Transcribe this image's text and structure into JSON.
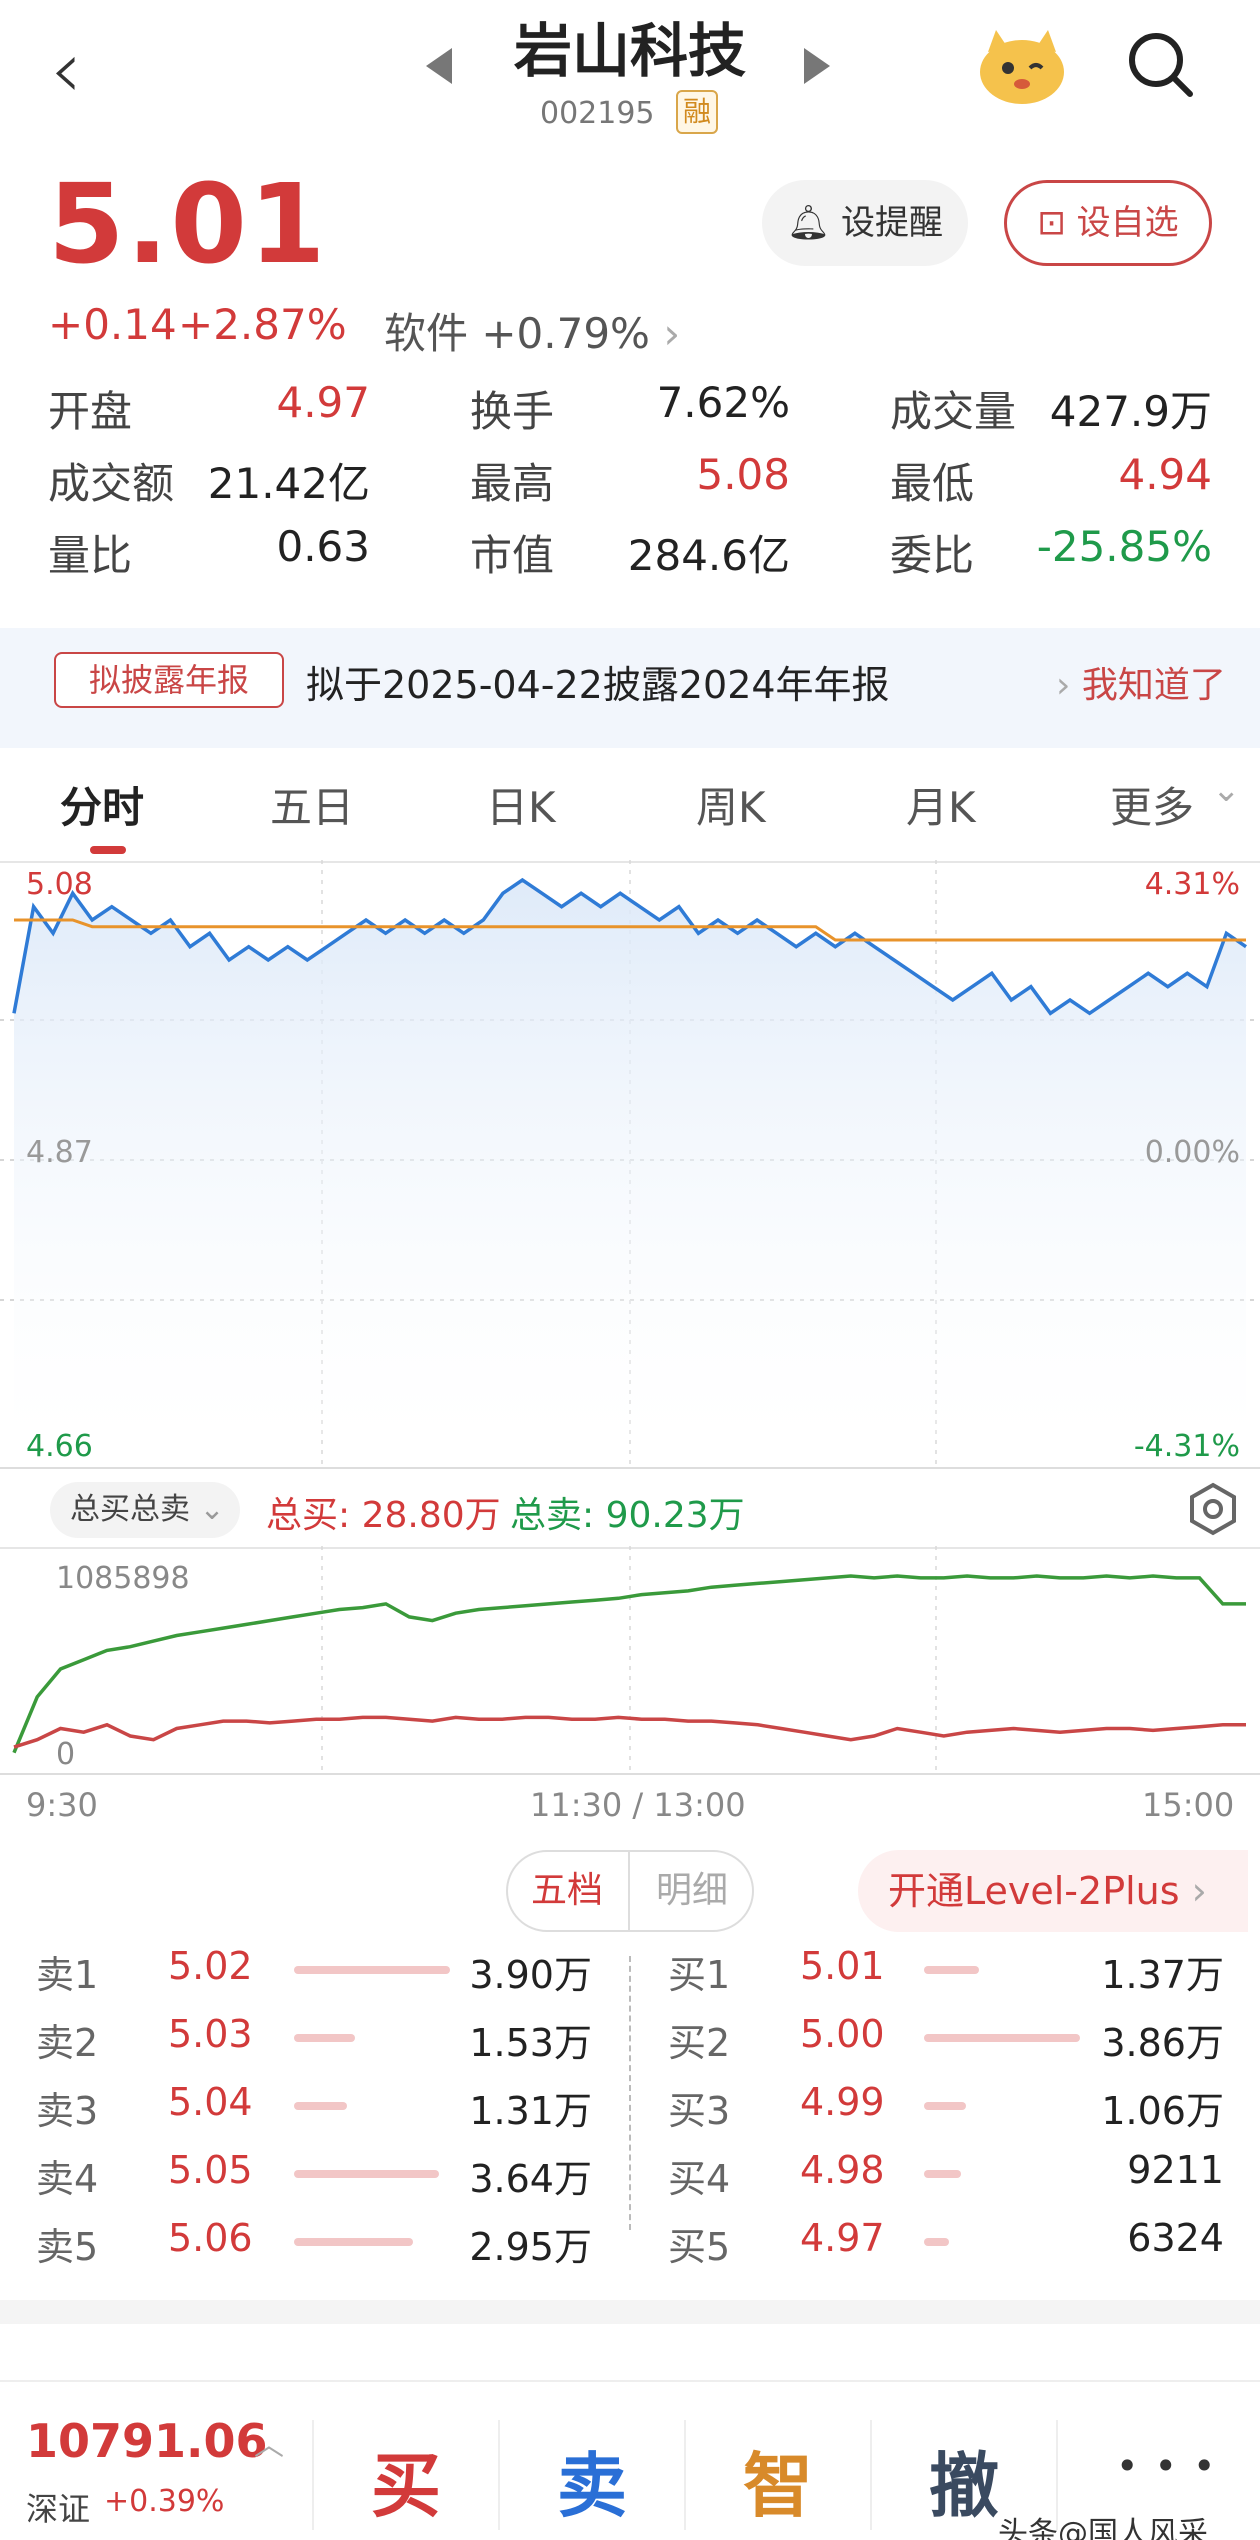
{
  "header": {
    "title": "岩山科技",
    "code": "002195",
    "badge": "融"
  },
  "quote": {
    "price": "5.01",
    "change": "+0.14",
    "change_pct": "+2.87%",
    "sector": "软件 +0.79%",
    "remind_label": "设提醒",
    "watch_label": "设自选"
  },
  "stats": [
    {
      "k": "开盘",
      "v": "4.97",
      "color": "red"
    },
    {
      "k": "换手",
      "v": "7.62%",
      "color": "dark"
    },
    {
      "k": "成交量",
      "v": "427.9万",
      "color": "dark"
    },
    {
      "k": "成交额",
      "v": "21.42亿",
      "color": "dark"
    },
    {
      "k": "最高",
      "v": "5.08",
      "color": "red"
    },
    {
      "k": "最低",
      "v": "4.94",
      "color": "red"
    },
    {
      "k": "量比",
      "v": "0.63",
      "color": "dark"
    },
    {
      "k": "市值",
      "v": "284.6亿",
      "color": "dark"
    },
    {
      "k": "委比",
      "v": "-25.85%",
      "color": "green"
    }
  ],
  "notice": {
    "badge": "拟披露年报",
    "text": "拟于2025-04-22披露2024年年报",
    "ack": "我知道了"
  },
  "tabs": [
    "分时",
    "五日",
    "日K",
    "周K",
    "月K",
    "更多"
  ],
  "chart_data": {
    "type": "line",
    "price_axis": {
      "top": "5.08",
      "mid": "4.87",
      "bottom": "4.66"
    },
    "pct_axis": {
      "top": "4.31%",
      "mid": "0.00%",
      "bottom": "-4.31%"
    },
    "time_labels": [
      "9:30",
      "11:30 / 13:00",
      "15:00"
    ],
    "series": [
      {
        "color": "#2f7bd6",
        "values": [
          4.98,
          5.06,
          5.04,
          5.07,
          5.05,
          5.06,
          5.05,
          5.04,
          5.05,
          5.03,
          5.04,
          5.02,
          5.03,
          5.02,
          5.03,
          5.02,
          5.03,
          5.04,
          5.05,
          5.04,
          5.05,
          5.04,
          5.05,
          5.04,
          5.05,
          5.07,
          5.08,
          5.07,
          5.06,
          5.07,
          5.06,
          5.07,
          5.06,
          5.05,
          5.06,
          5.04,
          5.05,
          5.04,
          5.05,
          5.04,
          5.03,
          5.04,
          5.03,
          5.04,
          5.03,
          5.02,
          5.01,
          5.0,
          4.99,
          5.0,
          5.01,
          4.99,
          5.0,
          4.98,
          4.99,
          4.98,
          4.99,
          5.0,
          5.01,
          5.0,
          5.01,
          5.0,
          5.04,
          5.03
        ]
      },
      {
        "color": "#e8932b",
        "values": [
          5.05,
          5.05,
          5.05,
          5.05,
          5.045,
          5.045,
          5.045,
          5.045,
          5.045,
          5.045,
          5.045,
          5.045,
          5.045,
          5.045,
          5.045,
          5.045,
          5.045,
          5.045,
          5.045,
          5.045,
          5.045,
          5.045,
          5.045,
          5.045,
          5.045,
          5.045,
          5.045,
          5.045,
          5.045,
          5.045,
          5.045,
          5.045,
          5.045,
          5.045,
          5.045,
          5.045,
          5.045,
          5.045,
          5.045,
          5.045,
          5.045,
          5.045,
          5.035,
          5.035,
          5.035,
          5.035,
          5.035,
          5.035,
          5.035,
          5.035,
          5.035,
          5.035,
          5.035,
          5.035,
          5.035,
          5.035,
          5.035,
          5.035,
          5.035,
          5.035,
          5.035,
          5.035,
          5.035,
          5.035
        ]
      }
    ]
  },
  "flow": {
    "mode_label": "总买总卖",
    "buy_label": "总买: 28.80万",
    "sell_label": "总卖: 90.23万",
    "axis_top": "1085898",
    "axis_bottom": "0",
    "chart_data": {
      "type": "line",
      "series": [
        {
          "color": "#3a9a3a",
          "values": [
            0.05,
            0.35,
            0.5,
            0.55,
            0.6,
            0.62,
            0.65,
            0.68,
            0.7,
            0.72,
            0.74,
            0.76,
            0.78,
            0.8,
            0.82,
            0.83,
            0.85,
            0.78,
            0.76,
            0.8,
            0.82,
            0.83,
            0.84,
            0.85,
            0.86,
            0.87,
            0.88,
            0.9,
            0.91,
            0.92,
            0.94,
            0.95,
            0.96,
            0.97,
            0.98,
            0.99,
            1.0,
            0.99,
            1.0,
            0.99,
            0.99,
            1.0,
            0.99,
            0.99,
            1.0,
            0.99,
            0.99,
            1.0,
            0.99,
            1.0,
            0.99,
            0.99,
            0.85,
            0.85
          ]
        },
        {
          "color": "#c94646",
          "values": [
            0.08,
            0.12,
            0.18,
            0.16,
            0.2,
            0.14,
            0.12,
            0.18,
            0.2,
            0.22,
            0.22,
            0.21,
            0.22,
            0.23,
            0.23,
            0.24,
            0.24,
            0.23,
            0.22,
            0.24,
            0.23,
            0.23,
            0.24,
            0.24,
            0.23,
            0.23,
            0.24,
            0.23,
            0.23,
            0.22,
            0.22,
            0.21,
            0.2,
            0.18,
            0.16,
            0.14,
            0.12,
            0.14,
            0.18,
            0.16,
            0.14,
            0.16,
            0.17,
            0.18,
            0.17,
            0.16,
            0.17,
            0.18,
            0.18,
            0.17,
            0.18,
            0.19,
            0.2,
            0.2
          ]
        }
      ]
    }
  },
  "orderbook": {
    "tab_active": "五档",
    "tab_other": "明细",
    "promo": "开通Level-2Plus",
    "sell": [
      {
        "label": "卖1",
        "price": "5.02",
        "vol": "3.90万",
        "bar": 1.0
      },
      {
        "label": "卖2",
        "price": "5.03",
        "vol": "1.53万",
        "bar": 0.39
      },
      {
        "label": "卖3",
        "price": "5.04",
        "vol": "1.31万",
        "bar": 0.34
      },
      {
        "label": "卖4",
        "price": "5.05",
        "vol": "3.64万",
        "bar": 0.93
      },
      {
        "label": "卖5",
        "price": "5.06",
        "vol": "2.95万",
        "bar": 0.76
      }
    ],
    "buy": [
      {
        "label": "买1",
        "price": "5.01",
        "vol": "1.37万",
        "bar": 0.35
      },
      {
        "label": "买2",
        "price": "5.00",
        "vol": "3.86万",
        "bar": 1.0
      },
      {
        "label": "买3",
        "price": "4.99",
        "vol": "1.06万",
        "bar": 0.27
      },
      {
        "label": "买4",
        "price": "4.98",
        "vol": "9211",
        "bar": 0.24
      },
      {
        "label": "买5",
        "price": "4.97",
        "vol": "6324",
        "bar": 0.16
      }
    ]
  },
  "bottom": {
    "index_value": "10791.06",
    "index_name": "深证",
    "index_change": "+0.39%",
    "actions": [
      "买",
      "卖",
      "智",
      "撤"
    ],
    "more": "• • •",
    "watermark": "头条@国人风采"
  }
}
